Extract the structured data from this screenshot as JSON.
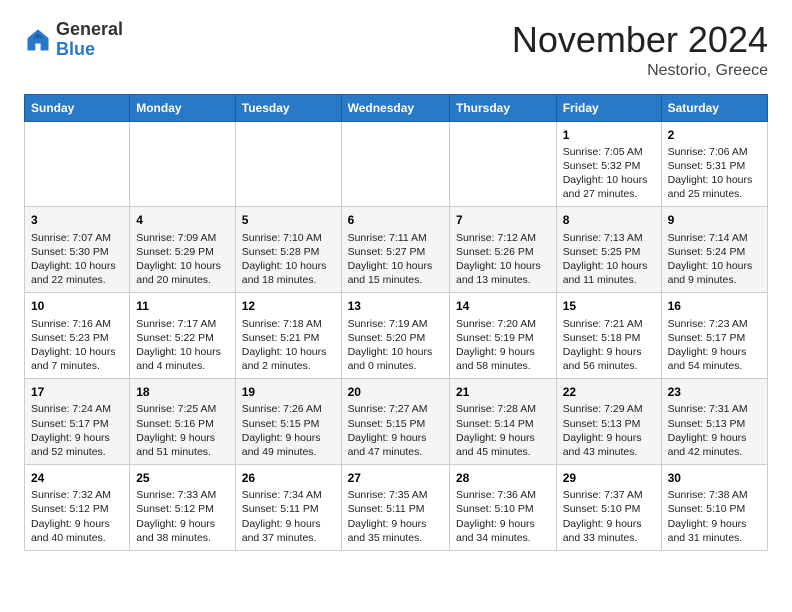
{
  "header": {
    "logo_general": "General",
    "logo_blue": "Blue",
    "month_title": "November 2024",
    "location": "Nestorio, Greece"
  },
  "weekdays": [
    "Sunday",
    "Monday",
    "Tuesday",
    "Wednesday",
    "Thursday",
    "Friday",
    "Saturday"
  ],
  "weeks": [
    [
      {
        "day": "",
        "info": ""
      },
      {
        "day": "",
        "info": ""
      },
      {
        "day": "",
        "info": ""
      },
      {
        "day": "",
        "info": ""
      },
      {
        "day": "",
        "info": ""
      },
      {
        "day": "1",
        "info": "Sunrise: 7:05 AM\nSunset: 5:32 PM\nDaylight: 10 hours\nand 27 minutes."
      },
      {
        "day": "2",
        "info": "Sunrise: 7:06 AM\nSunset: 5:31 PM\nDaylight: 10 hours\nand 25 minutes."
      }
    ],
    [
      {
        "day": "3",
        "info": "Sunrise: 7:07 AM\nSunset: 5:30 PM\nDaylight: 10 hours\nand 22 minutes."
      },
      {
        "day": "4",
        "info": "Sunrise: 7:09 AM\nSunset: 5:29 PM\nDaylight: 10 hours\nand 20 minutes."
      },
      {
        "day": "5",
        "info": "Sunrise: 7:10 AM\nSunset: 5:28 PM\nDaylight: 10 hours\nand 18 minutes."
      },
      {
        "day": "6",
        "info": "Sunrise: 7:11 AM\nSunset: 5:27 PM\nDaylight: 10 hours\nand 15 minutes."
      },
      {
        "day": "7",
        "info": "Sunrise: 7:12 AM\nSunset: 5:26 PM\nDaylight: 10 hours\nand 13 minutes."
      },
      {
        "day": "8",
        "info": "Sunrise: 7:13 AM\nSunset: 5:25 PM\nDaylight: 10 hours\nand 11 minutes."
      },
      {
        "day": "9",
        "info": "Sunrise: 7:14 AM\nSunset: 5:24 PM\nDaylight: 10 hours\nand 9 minutes."
      }
    ],
    [
      {
        "day": "10",
        "info": "Sunrise: 7:16 AM\nSunset: 5:23 PM\nDaylight: 10 hours\nand 7 minutes."
      },
      {
        "day": "11",
        "info": "Sunrise: 7:17 AM\nSunset: 5:22 PM\nDaylight: 10 hours\nand 4 minutes."
      },
      {
        "day": "12",
        "info": "Sunrise: 7:18 AM\nSunset: 5:21 PM\nDaylight: 10 hours\nand 2 minutes."
      },
      {
        "day": "13",
        "info": "Sunrise: 7:19 AM\nSunset: 5:20 PM\nDaylight: 10 hours\nand 0 minutes."
      },
      {
        "day": "14",
        "info": "Sunrise: 7:20 AM\nSunset: 5:19 PM\nDaylight: 9 hours\nand 58 minutes."
      },
      {
        "day": "15",
        "info": "Sunrise: 7:21 AM\nSunset: 5:18 PM\nDaylight: 9 hours\nand 56 minutes."
      },
      {
        "day": "16",
        "info": "Sunrise: 7:23 AM\nSunset: 5:17 PM\nDaylight: 9 hours\nand 54 minutes."
      }
    ],
    [
      {
        "day": "17",
        "info": "Sunrise: 7:24 AM\nSunset: 5:17 PM\nDaylight: 9 hours\nand 52 minutes."
      },
      {
        "day": "18",
        "info": "Sunrise: 7:25 AM\nSunset: 5:16 PM\nDaylight: 9 hours\nand 51 minutes."
      },
      {
        "day": "19",
        "info": "Sunrise: 7:26 AM\nSunset: 5:15 PM\nDaylight: 9 hours\nand 49 minutes."
      },
      {
        "day": "20",
        "info": "Sunrise: 7:27 AM\nSunset: 5:15 PM\nDaylight: 9 hours\nand 47 minutes."
      },
      {
        "day": "21",
        "info": "Sunrise: 7:28 AM\nSunset: 5:14 PM\nDaylight: 9 hours\nand 45 minutes."
      },
      {
        "day": "22",
        "info": "Sunrise: 7:29 AM\nSunset: 5:13 PM\nDaylight: 9 hours\nand 43 minutes."
      },
      {
        "day": "23",
        "info": "Sunrise: 7:31 AM\nSunset: 5:13 PM\nDaylight: 9 hours\nand 42 minutes."
      }
    ],
    [
      {
        "day": "24",
        "info": "Sunrise: 7:32 AM\nSunset: 5:12 PM\nDaylight: 9 hours\nand 40 minutes."
      },
      {
        "day": "25",
        "info": "Sunrise: 7:33 AM\nSunset: 5:12 PM\nDaylight: 9 hours\nand 38 minutes."
      },
      {
        "day": "26",
        "info": "Sunrise: 7:34 AM\nSunset: 5:11 PM\nDaylight: 9 hours\nand 37 minutes."
      },
      {
        "day": "27",
        "info": "Sunrise: 7:35 AM\nSunset: 5:11 PM\nDaylight: 9 hours\nand 35 minutes."
      },
      {
        "day": "28",
        "info": "Sunrise: 7:36 AM\nSunset: 5:10 PM\nDaylight: 9 hours\nand 34 minutes."
      },
      {
        "day": "29",
        "info": "Sunrise: 7:37 AM\nSunset: 5:10 PM\nDaylight: 9 hours\nand 33 minutes."
      },
      {
        "day": "30",
        "info": "Sunrise: 7:38 AM\nSunset: 5:10 PM\nDaylight: 9 hours\nand 31 minutes."
      }
    ]
  ]
}
